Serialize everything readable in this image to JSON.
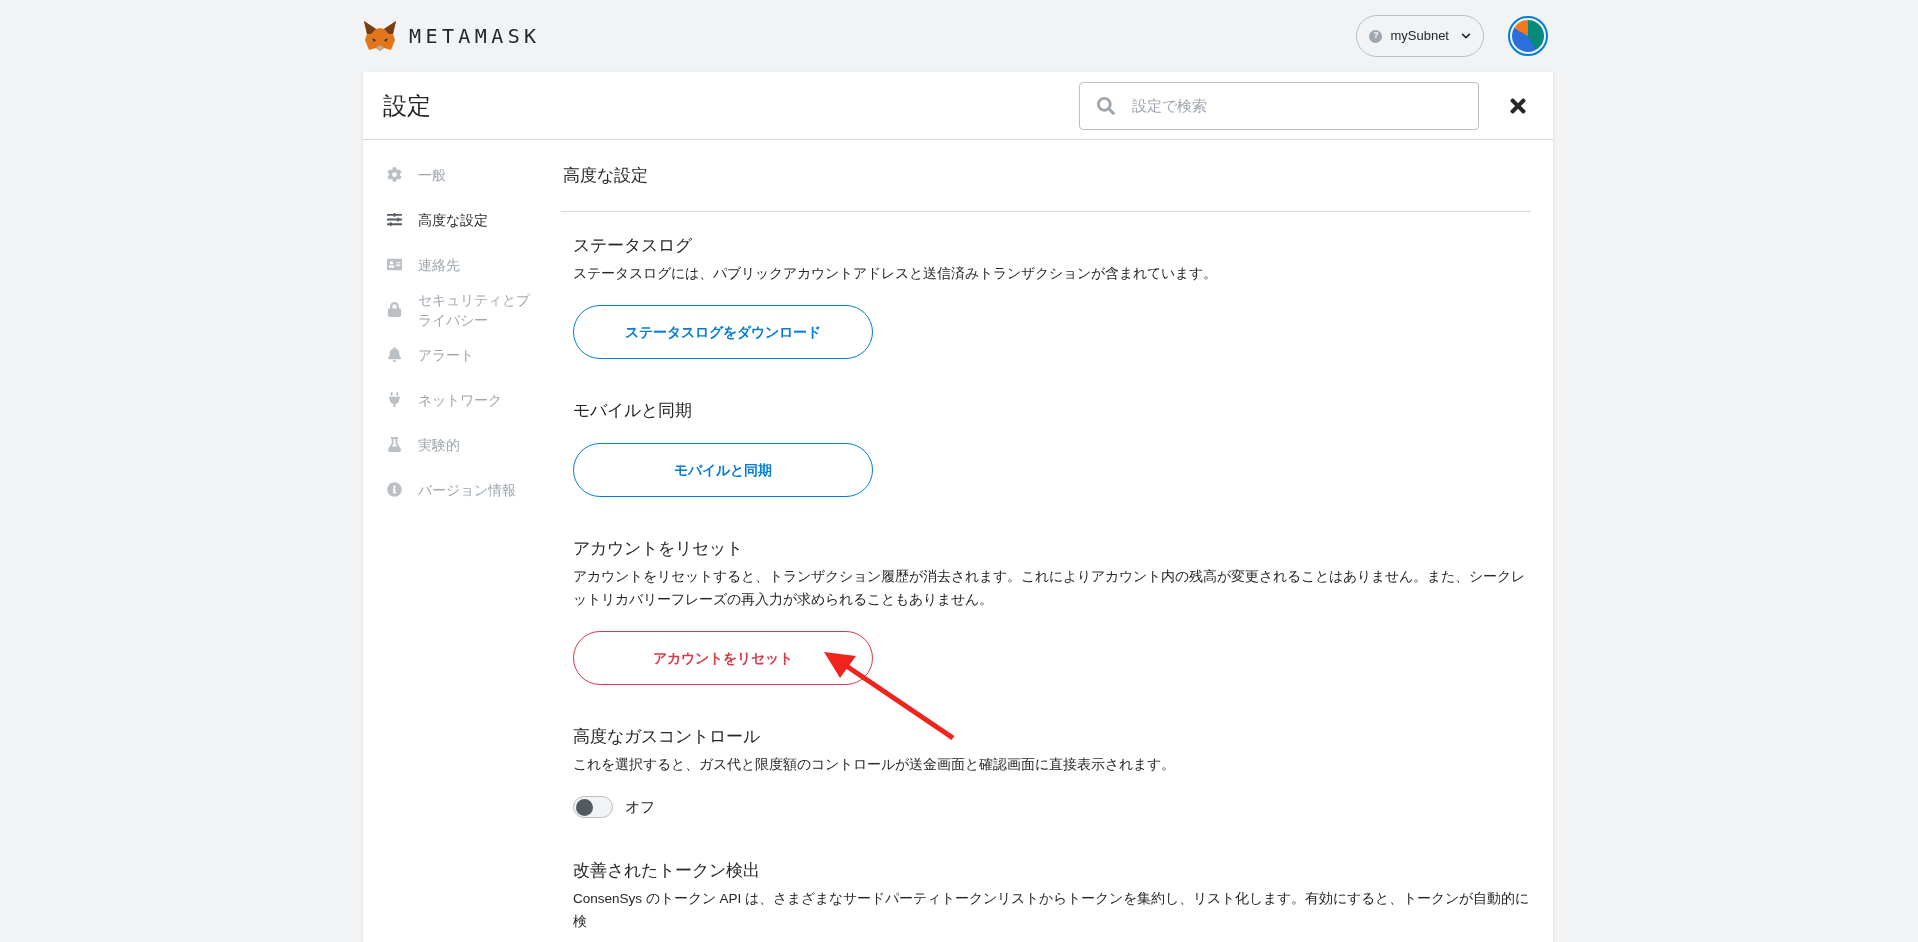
{
  "header": {
    "logo_text": "METAMASK",
    "network": {
      "label": "mySubnet",
      "badge": "?"
    }
  },
  "settings": {
    "title": "設定",
    "search": {
      "placeholder": "設定で検索"
    }
  },
  "sidebar": {
    "items": [
      {
        "label": "一般",
        "selected": false
      },
      {
        "label": "高度な設定",
        "selected": true
      },
      {
        "label": "連絡先",
        "selected": false
      },
      {
        "label": "セキュリティとプライバシー",
        "selected": false
      },
      {
        "label": "アラート",
        "selected": false
      },
      {
        "label": "ネットワーク",
        "selected": false
      },
      {
        "label": "実験的",
        "selected": false
      },
      {
        "label": "バージョン情報",
        "selected": false
      }
    ]
  },
  "content": {
    "title": "高度な設定",
    "sections": [
      {
        "kind": "button",
        "title": "ステータスログ",
        "description": "ステータスログには、パブリックアカウントアドレスと送信済みトランザクションが含まれています。",
        "button": "ステータスログをダウンロード"
      },
      {
        "kind": "button",
        "title": "モバイルと同期",
        "button": "モバイルと同期"
      },
      {
        "kind": "danger",
        "title": "アカウントをリセット",
        "description": "アカウントをリセットすると、トランザクション履歴が消去されます。これによりアカウント内の残高が変更されることはありません。また、シークレットリカバリーフレーズの再入力が求められることもありません。",
        "button": "アカウントをリセット"
      },
      {
        "kind": "toggle",
        "title": "高度なガスコントロール",
        "description": "これを選択すると、ガス代と限度額のコントロールが送金画面と確認画面に直接表示されます。",
        "on": false,
        "state_label": "オフ"
      },
      {
        "kind": "text",
        "title": "改善されたトークン検出",
        "description": "ConsenSys のトークン API は、さまざまなサードパーティトークンリストからトークンを集約し、リスト化します。有効にすると、トークンが自動的に検"
      }
    ]
  }
}
